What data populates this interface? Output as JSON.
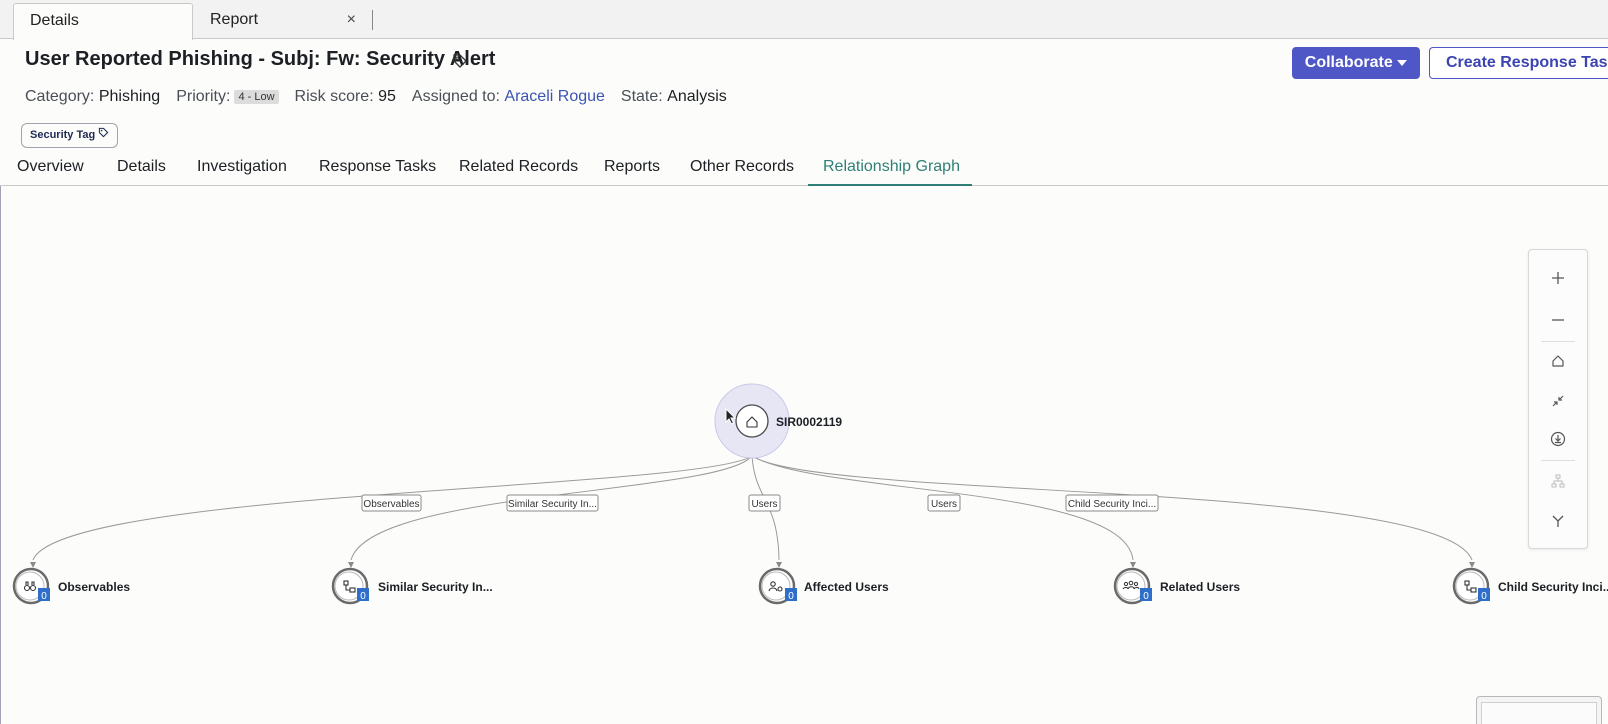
{
  "tabs": [
    {
      "label": "Details"
    },
    {
      "label": "Report",
      "close": "×"
    }
  ],
  "record": {
    "title": "User Reported Phishing - Subj: Fw: Security Alert",
    "category_label": "Category:",
    "category": "Phishing",
    "priority_label": "Priority:",
    "priority": "4 - Low",
    "risk_label": "Risk score:",
    "risk": "95",
    "assigned_label": "Assigned to:",
    "assigned": "Araceli Rogue",
    "state_label": "State:",
    "state": "Analysis",
    "tag": "Security Tag"
  },
  "buttons": {
    "collaborate": "Collaborate",
    "create_task": "Create Response Task"
  },
  "section_tabs": [
    "Overview",
    "Details",
    "Investigation",
    "Response Tasks",
    "Related Records",
    "Reports",
    "Other Records",
    "Relationship Graph"
  ],
  "active_section_tab": "Relationship Graph",
  "graph": {
    "root": {
      "label": "SIR0002119",
      "icon": "home-icon"
    },
    "edge_labels": [
      "Observables",
      "Similar Security In...",
      "Users",
      "Users",
      "Child Security Inci..."
    ],
    "nodes": [
      {
        "label": "Observables",
        "count": "0",
        "icon": "binoculars-icon"
      },
      {
        "label": "Similar Security In...",
        "count": "0",
        "icon": "hierarchy-icon"
      },
      {
        "label": "Affected Users",
        "count": "0",
        "icon": "user-tag-icon"
      },
      {
        "label": "Related Users",
        "count": "0",
        "icon": "group-icon"
      },
      {
        "label": "Child Security Inci...",
        "count": "0",
        "icon": "hierarchy-icon"
      }
    ]
  },
  "toolbar": [
    "zoom-in-icon",
    "zoom-out-icon",
    "home-icon",
    "collapse-icon",
    "download-icon",
    "layout-tree-icon",
    "fork-icon"
  ],
  "colors": {
    "accent": "#4f57c6",
    "active_tab": "#2f7f76",
    "link": "#3c55b4",
    "badge": "#2f6fc9"
  }
}
